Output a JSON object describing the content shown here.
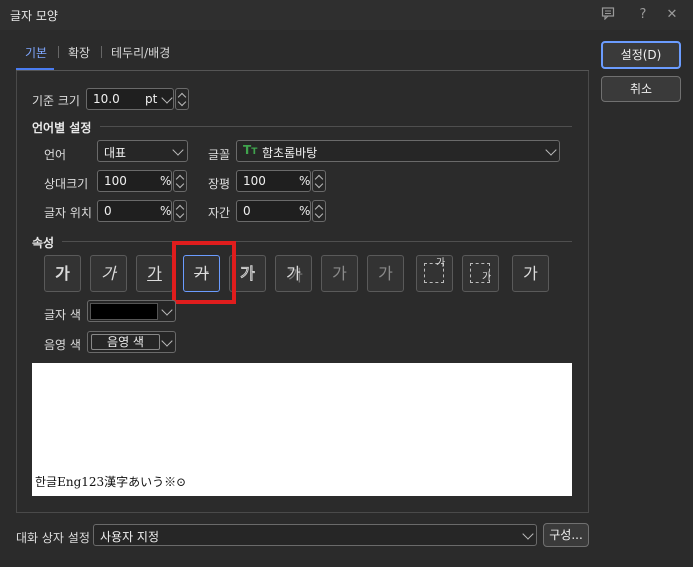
{
  "window": {
    "title": "글자 모양",
    "icons": [
      "comment-icon",
      "help-icon",
      "close-icon"
    ],
    "help_glyph": "?",
    "close_glyph": "✕"
  },
  "tabs": [
    {
      "label": "기본",
      "active": true
    },
    {
      "label": "확장",
      "active": false
    },
    {
      "label": "테두리/배경",
      "active": false
    }
  ],
  "basic": {
    "base_size_label": "기준 크기",
    "base_size_value": "10.0",
    "base_size_unit": "pt"
  },
  "lang_section": {
    "title": "언어별 설정",
    "language_label": "언어",
    "language_value": "대표",
    "font_label": "글꼴",
    "font_value": "함초롬바탕",
    "font_icon": "truetype-icon",
    "rel_size_label": "상대크기",
    "rel_size_value": "100",
    "rel_size_unit": "%",
    "width_ratio_label": "장평",
    "width_ratio_value": "100",
    "width_ratio_unit": "%",
    "position_label": "글자 위치",
    "position_value": "0",
    "position_unit": "%",
    "spacing_label": "자간",
    "spacing_value": "0",
    "spacing_unit": "%"
  },
  "attr_section": {
    "title": "속성",
    "buttons": [
      {
        "name": "bold-button",
        "glyph": "가"
      },
      {
        "name": "italic-button",
        "glyph": "가"
      },
      {
        "name": "underline-button",
        "glyph": "가"
      },
      {
        "name": "strikethrough-button",
        "glyph": "가"
      },
      {
        "name": "outline-button",
        "glyph": "가"
      },
      {
        "name": "shadow-button",
        "glyph": "가"
      },
      {
        "name": "emboss-button",
        "glyph": "가"
      },
      {
        "name": "engrave-button",
        "glyph": "가"
      },
      {
        "name": "superscript-button",
        "glyph": "가"
      },
      {
        "name": "subscript-button",
        "glyph": "가"
      },
      {
        "name": "normal-button",
        "glyph": "가"
      }
    ],
    "text_color_label": "글자 색",
    "text_color": "#000000",
    "shade_color_label": "음영 색",
    "shade_color_value": "음영 색"
  },
  "preview": {
    "sample": "한글Eng123漢字あいう※⊙"
  },
  "footer": {
    "dialog_setting_label": "대화 상자 설정",
    "dialog_setting_value": "사용자 지정",
    "compose_button": "구성..."
  },
  "actions": {
    "ok": "설정(D)",
    "cancel": "취소"
  },
  "colors": {
    "accent": "#4a7cf0",
    "highlight_box": "#e01d1d",
    "font_icon_color": "#3fa34d"
  }
}
